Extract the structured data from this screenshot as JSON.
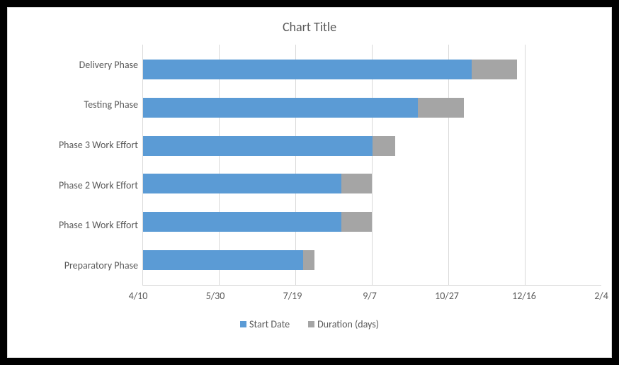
{
  "chart_data": {
    "type": "bar",
    "orientation": "horizontal",
    "stacked": true,
    "title": "Chart Title",
    "categories": [
      "Delivery Phase",
      "Testing Phase",
      "Phase 3 Work Effort",
      "Phase 2 Work Effort",
      "Phase 1 Work Effort",
      "Preparatory Phase"
    ],
    "x_ticks": [
      "4/10",
      "5/30",
      "7/19",
      "9/7",
      "10/27",
      "12/16",
      "2/4"
    ],
    "x_range_days": [
      0,
      300
    ],
    "x_tick_interval_days": 50,
    "x_origin_date": "4/10",
    "series": [
      {
        "name": "Start Date",
        "color": "#5b9bd5",
        "values_days_from_origin": [
          215,
          180,
          150,
          130,
          130,
          105
        ]
      },
      {
        "name": "Duration (days)",
        "color": "#a5a5a5",
        "values_days": [
          30,
          30,
          15,
          20,
          20,
          7
        ]
      }
    ],
    "legend_position": "bottom",
    "grid": true,
    "ylabel": "",
    "xlabel": ""
  }
}
